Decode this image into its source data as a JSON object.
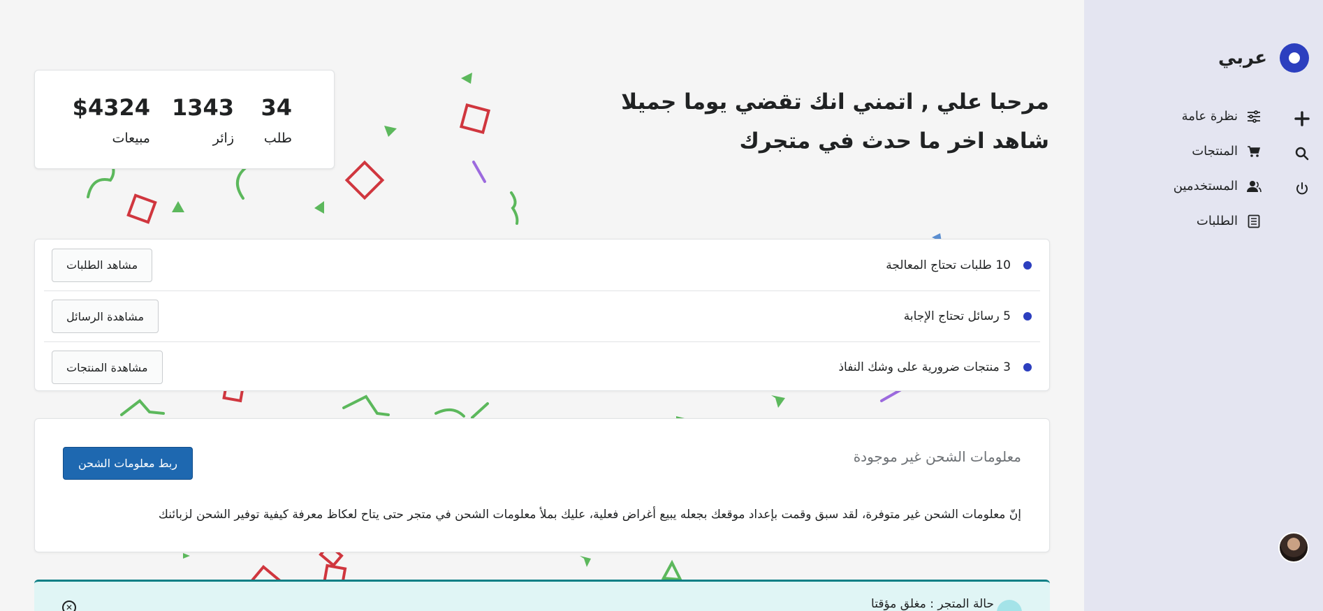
{
  "sidebar": {
    "brand": {
      "name": "عربي",
      "logo_icon": "circle-logo-icon"
    },
    "actions": [
      {
        "icon": "plus-icon",
        "name": "add"
      },
      {
        "icon": "search-icon",
        "name": "search"
      },
      {
        "icon": "power-icon",
        "name": "logout"
      }
    ],
    "nav": [
      {
        "label": "نظرة عامة",
        "icon": "sliders-icon"
      },
      {
        "label": "المنتجات",
        "icon": "cart-icon"
      },
      {
        "label": "المستخدمين",
        "icon": "users-icon"
      },
      {
        "label": "الطلبات",
        "icon": "document-icon"
      }
    ],
    "profile_icon": "avatar"
  },
  "greeting": {
    "line1": "مرحبا علي , اتمني انك تقضي يوما جميلا",
    "line2": "شاهد اخر ما حدث في متجرك"
  },
  "stats": [
    {
      "value": "34",
      "label": "طلب"
    },
    {
      "value": "1343",
      "label": "زائر"
    },
    {
      "value": "$4324",
      "label": "مبيعات"
    }
  ],
  "tasks": [
    {
      "text": "10 طلبات تحتاج المعالجة",
      "button": "مشاهد الطلبات"
    },
    {
      "text": "5 رسائل تحتاج الإجابة",
      "button": "مشاهدة الرسائل"
    },
    {
      "text": "3 منتجات ضرورية على وشك النفاذ",
      "button": "مشاهدة المنتجات"
    }
  ],
  "shipping": {
    "title": "معلومات الشحن غير موجودة",
    "button": "ربط معلومات الشحن",
    "description": "إنّ معلومات الشحن غير متوفرة، لقد سبق وقمت بإعداد موقعك بجعله يبيع أغراض فعلية، عليك بملأ معلومات الشحن في متجر حتى يتاح لعكاظ معرفة كيفية توفير الشحن لزبائنك"
  },
  "banner": {
    "text": "حالة المتجر : مغلق مؤقتا",
    "close_icon": "close-icon"
  },
  "colors": {
    "accent": "#2c3fbf",
    "primary_button": "#1e68b0",
    "sidebar_bg": "#e4e5f1",
    "confetti_green": "#5cb85c",
    "confetti_red": "#d0363e",
    "confetti_purple": "#9c6ade",
    "banner_bg": "#e0f5f5",
    "banner_border": "#0b7f85"
  }
}
